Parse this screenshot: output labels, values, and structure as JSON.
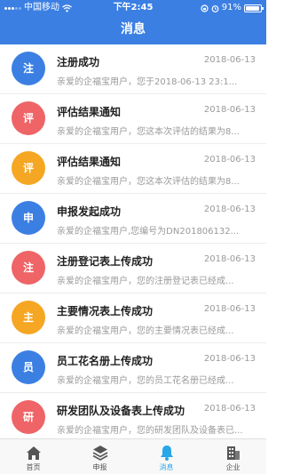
{
  "status_bar": {
    "carrier": "中国移动",
    "time": "下午2:45",
    "battery_text": "91%"
  },
  "header": {
    "title": "消息"
  },
  "colors": {
    "blue": "#3b7fe3",
    "red": "#ee6467",
    "orange": "#f5a623",
    "active_tab": "#2aa7e8"
  },
  "messages": [
    {
      "badge": "注",
      "color": "blue",
      "title": "注册成功",
      "date": "2018-06-13",
      "preview": "亲爱的企福宝用户，您于2018-06-13 23:1..."
    },
    {
      "badge": "评",
      "color": "red",
      "title": "评估结果通知",
      "date": "2018-06-13",
      "preview": "亲爱的企福宝用户，您这本次评估的结果为8..."
    },
    {
      "badge": "评",
      "color": "orange",
      "title": "评估结果通知",
      "date": "2018-06-13",
      "preview": "亲爱的企福宝用户，您这本次评估的结果为8..."
    },
    {
      "badge": "申",
      "color": "blue",
      "title": "申报发起成功",
      "date": "2018-06-13",
      "preview": "亲爱的企福宝用户,您编号为DN201806132..."
    },
    {
      "badge": "注",
      "color": "red",
      "title": "注册登记表上传成功",
      "date": "2018-06-13",
      "preview": "亲爱的企福宝用户，您的注册登记表已经成..."
    },
    {
      "badge": "主",
      "color": "orange",
      "title": "主要情况表上传成功",
      "date": "2018-06-13",
      "preview": "亲爱的企福宝用户，您的主要情况表已经成..."
    },
    {
      "badge": "员",
      "color": "blue",
      "title": "员工花名册上传成功",
      "date": "2018-06-13",
      "preview": "亲爱的企福宝用户，您的员工花名册已经成..."
    },
    {
      "badge": "研",
      "color": "red",
      "title": "研发团队及设备表上传成功",
      "date": "2018-06-13",
      "preview": "亲爱的企福宝用户，您的研发团队及设备表已..."
    }
  ],
  "tabs": [
    {
      "label": "首页",
      "icon": "home-icon",
      "active": false
    },
    {
      "label": "申报",
      "icon": "layers-icon",
      "active": false
    },
    {
      "label": "消息",
      "icon": "bell-icon",
      "active": true
    },
    {
      "label": "企业",
      "icon": "building-icon",
      "active": false
    }
  ]
}
